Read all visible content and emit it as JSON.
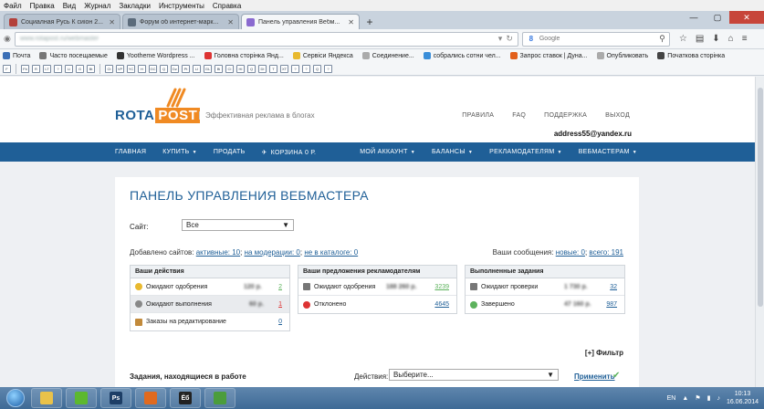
{
  "menu": [
    "Файл",
    "Правка",
    "Вид",
    "Журнал",
    "Закладки",
    "Инструменты",
    "Справка"
  ],
  "tabs": [
    {
      "label": "Социалная Русь К сиіон 2...",
      "color": "#b3413b"
    },
    {
      "label": "Форум об интернет-марк...",
      "color": "#5b6b7b"
    },
    {
      "label": "Панель управления Вебм...",
      "color": "#8a6ad0"
    }
  ],
  "nav": {
    "url": "www.rotapost.ru/webmaster",
    "search_placeholder": "Google"
  },
  "bookmarks": [
    {
      "label": "Почта",
      "color": "#3b6fb6"
    },
    {
      "label": "Часто посещаемые",
      "color": "#777"
    },
    {
      "label": "Yootheme Wordpress ...",
      "color": "#333"
    },
    {
      "label": "Головна сторінка Янд...",
      "color": "#d33"
    },
    {
      "label": "Сервіси Яндекса",
      "color": "#e8b92f"
    },
    {
      "label": "Соединение...",
      "color": "#aaa"
    },
    {
      "label": "собрались сотни чел...",
      "color": "#3a8ed9"
    },
    {
      "label": "Запрос ставок | Дуна...",
      "color": "#e25f1b"
    },
    {
      "label": "Опубликовать",
      "color": "#aaa"
    },
    {
      "label": "Початкова сторінка",
      "color": "#444"
    }
  ],
  "iconrow": [
    "F",
    "Fb",
    "R",
    "LT",
    "?",
    "Li",
    "G",
    "Bt",
    "Ct",
    "VP",
    "YC",
    "H",
    "GC",
    "Q",
    "Dz",
    "Pt",
    "LI",
    "GL",
    "Bi",
    "CI",
    "HI",
    "Q",
    "DI",
    "T",
    "XT",
    "?",
    "?",
    "Q",
    "?"
  ],
  "site": {
    "logo_left": "ROTA",
    "logo_right": "POST",
    "tagline": "Эффективная реклама в блогах",
    "links": [
      "ПРАВИЛА",
      "FAQ",
      "ПОДДЕРЖКА",
      "ВЫХОД"
    ],
    "email": "address55@yandex.ru",
    "nav_left": [
      "ГЛАВНАЯ",
      "КУПИТЬ",
      "ПРОДАТЬ",
      "КОРЗИНА 0 Р."
    ],
    "nav_right": [
      "МОЙ АККАУНТ",
      "БАЛАНСЫ",
      "РЕКЛАМОДАТЕЛЯМ",
      "ВЕБМАСТЕРАМ"
    ]
  },
  "panel": {
    "title": "ПАНЕЛЬ УПРАВЛЕНИЯ ВЕБМАСТЕРА",
    "site_label": "Сайт:",
    "site_value": "Все",
    "added_prefix": "Добавлено сайтов:",
    "added_active": "активные: 10",
    "added_moderation": "на модерации: 0",
    "added_catalog": "не в каталоге: 0",
    "messages_prefix": "Ваши сообщения:",
    "messages_new": "новые: 0",
    "messages_all": "всего: 191",
    "filter": "[+] Фильтр",
    "tasks_title": "Задания, находящиеся в работе",
    "actions_label": "Действия:",
    "actions_value": "Выберите...",
    "apply": "Применить"
  },
  "boxes": [
    {
      "title": "Ваши действия",
      "rows": [
        {
          "label": "Ожидают одобрения",
          "amount": "120 р.",
          "count": "2",
          "icon": "#e9b92f"
        },
        {
          "label": "Ожидают выполнения",
          "amount": "60 р.",
          "count": "1",
          "icon": "#888"
        },
        {
          "label": "Заказы на редактирование",
          "amount": "",
          "count": "0",
          "icon": "#c28a3b"
        }
      ]
    },
    {
      "title": "Ваши предложения рекламодателям",
      "rows": [
        {
          "label": "Ожидают одобрения",
          "amount": "188 260 р.",
          "count": "3239",
          "icon": "#777"
        },
        {
          "label": "Отклонено",
          "amount": "",
          "count": "4645",
          "icon": "#d33"
        }
      ]
    },
    {
      "title": "Выполненные задания",
      "rows": [
        {
          "label": "Ожидают проверки",
          "amount": "1 730 р.",
          "count": "32",
          "icon": "#777"
        },
        {
          "label": "Завершено",
          "amount": "47 160 р.",
          "count": "987",
          "icon": "#5cb25c"
        }
      ]
    }
  ],
  "taskbar": {
    "apps": [
      {
        "name": "explorer",
        "label": "",
        "color": "#e9c24a"
      },
      {
        "name": "icq",
        "label": "",
        "color": "#5cb82f"
      },
      {
        "name": "photoshop",
        "label": "Ps",
        "color": "#1d3e66"
      },
      {
        "name": "firefox",
        "label": "",
        "color": "#e06a1f"
      },
      {
        "name": "app-yo",
        "label": "Ёб",
        "color": "#222"
      },
      {
        "name": "chart-app",
        "label": "",
        "color": "#4b9d3c"
      }
    ],
    "lang": "EN",
    "time": "10:13",
    "date": "16.06.2014"
  }
}
